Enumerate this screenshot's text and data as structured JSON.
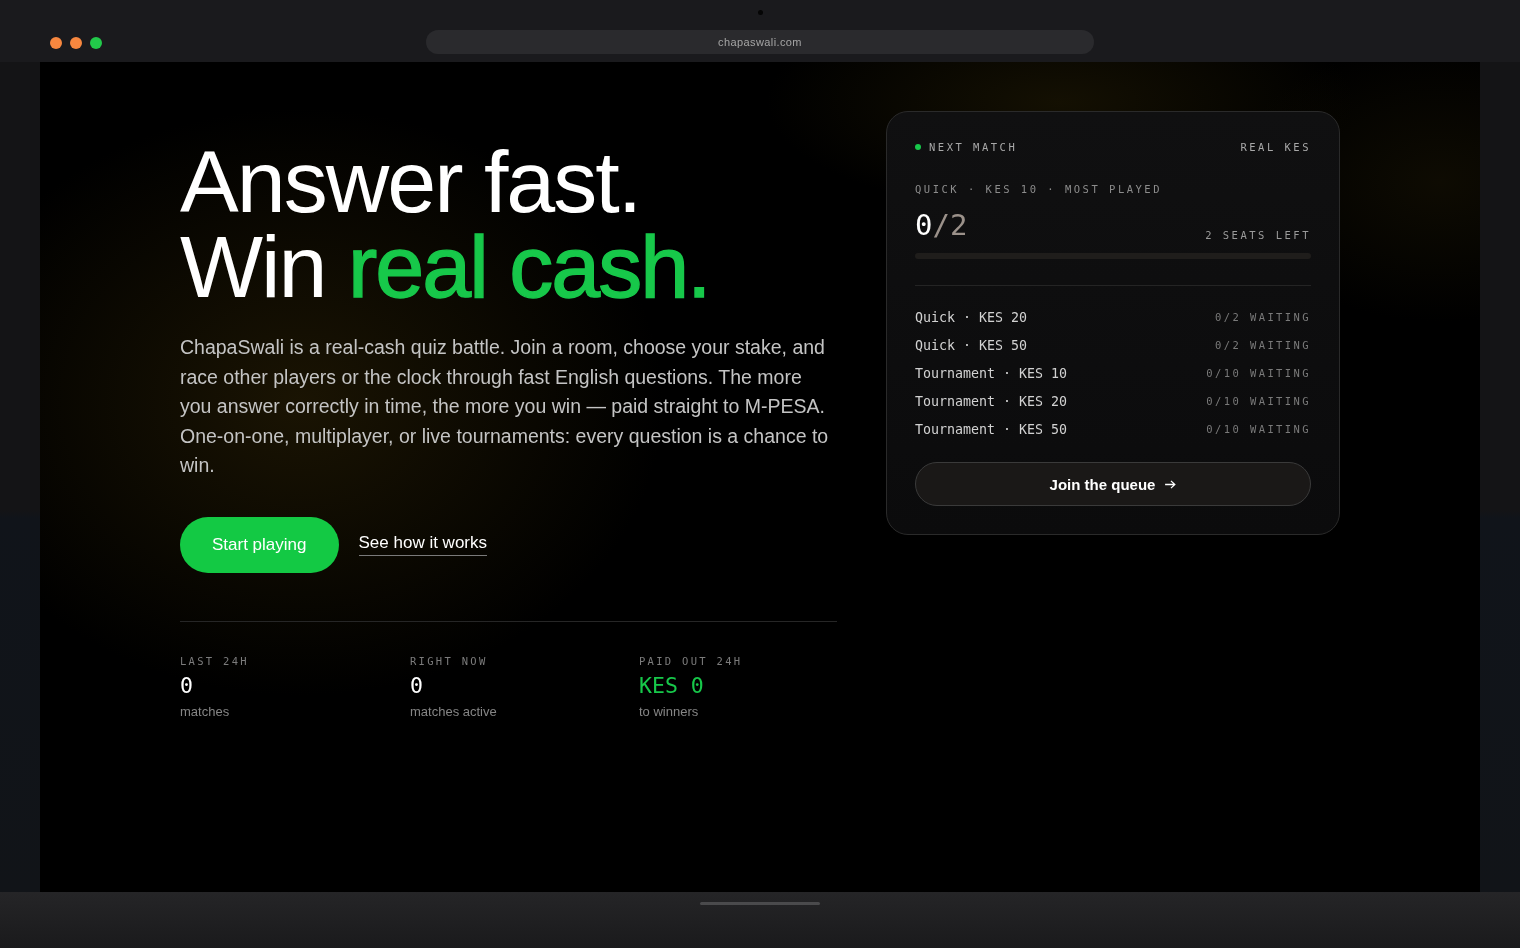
{
  "browser": {
    "url": "chapaswali.com"
  },
  "hero": {
    "headline": {
      "line_1": "Answer fast.",
      "line_2": "Win",
      "line_2_highlight": "real cash."
    },
    "description": "ChapaSwali is a real-cash quiz battle. Join a room, choose your stake, and race other players or the clock through fast English questions. The more you answer correctly in time, the more you win — paid straight to M-PESA. One-on-one, multiplayer, or live tournaments: every question is a chance to win.",
    "primary_button": "Start playing",
    "secondary_link": "See how it works"
  },
  "stats": [
    {
      "label": "LAST 24H",
      "value": "0",
      "caption": "matches",
      "highlight": false
    },
    {
      "label": "RIGHT NOW",
      "value": "0",
      "caption": "matches active",
      "highlight": false
    },
    {
      "label": "PAID OUT 24H",
      "value": "KES 0",
      "caption": "to winners",
      "highlight": true
    }
  ],
  "match_card": {
    "eyebrow": "NEXT MATCH",
    "badge": "REAL KES",
    "featured": {
      "title": "QUICK · KES 10 · MOST PLAYED",
      "filled": "0",
      "capacity": "/2",
      "seats_left": "2 SEATS LEFT",
      "level": 0
    },
    "rooms": [
      {
        "name": "Quick · KES 20",
        "status": "0/2 WAITING"
      },
      {
        "name": "Quick · KES 50",
        "status": "0/2 WAITING"
      },
      {
        "name": "Tournament · KES 10",
        "status": "0/10 WAITING"
      },
      {
        "name": "Tournament · KES 20",
        "status": "0/10 WAITING"
      },
      {
        "name": "Tournament · KES 50",
        "status": "0/10 WAITING"
      }
    ],
    "join_button": "Join the queue"
  }
}
